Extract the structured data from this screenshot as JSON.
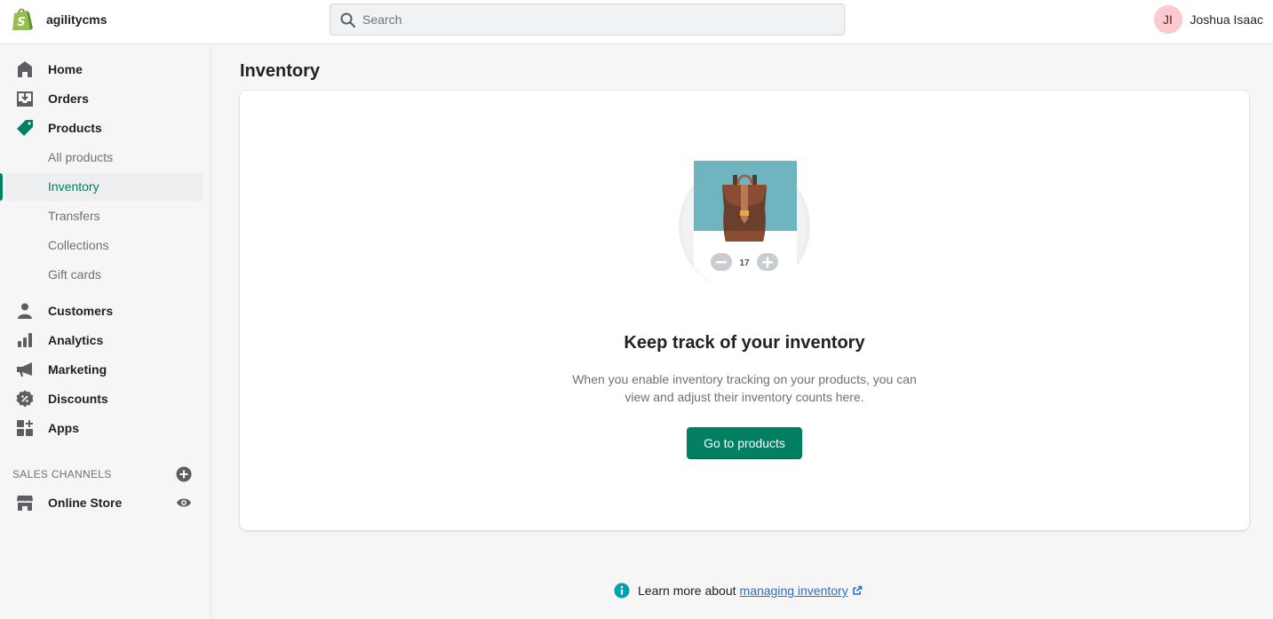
{
  "topbar": {
    "store_name": "agilitycms",
    "search_placeholder": "Search",
    "search_value": "",
    "user": {
      "initials": "JI",
      "name": "Joshua Isaac",
      "avatar_color": "#fdc9d0"
    }
  },
  "sidebar": {
    "items": [
      {
        "label": "Home",
        "icon": "home-icon"
      },
      {
        "label": "Orders",
        "icon": "orders-icon"
      },
      {
        "label": "Products",
        "icon": "tag-icon",
        "active": true
      }
    ],
    "product_subitems": [
      {
        "label": "All products"
      },
      {
        "label": "Inventory",
        "active": true
      },
      {
        "label": "Transfers"
      },
      {
        "label": "Collections"
      },
      {
        "label": "Gift cards"
      }
    ],
    "items_after": [
      {
        "label": "Customers",
        "icon": "customer-icon"
      },
      {
        "label": "Analytics",
        "icon": "analytics-icon"
      },
      {
        "label": "Marketing",
        "icon": "megaphone-icon"
      },
      {
        "label": "Discounts",
        "icon": "discount-icon"
      },
      {
        "label": "Apps",
        "icon": "apps-icon"
      }
    ],
    "sales_channels": {
      "title": "SALES CHANNELS",
      "items": [
        {
          "label": "Online Store",
          "icon": "store-icon",
          "action_icon": "eye-icon"
        }
      ]
    }
  },
  "main": {
    "page_title": "Inventory",
    "empty_state": {
      "illustration_counter": "17",
      "title": "Keep track of your inventory",
      "description": "When you enable inventory tracking on your products, you can view and adjust their inventory counts here.",
      "button_label": "Go to products"
    },
    "footer_help": {
      "prefix": "Learn more about",
      "link_text": "managing inventory"
    }
  },
  "colors": {
    "brand_green": "#008060",
    "link_blue": "#2c6ecb",
    "info_teal": "#00a0ac",
    "illustration_sky": "#6fb5bf"
  }
}
